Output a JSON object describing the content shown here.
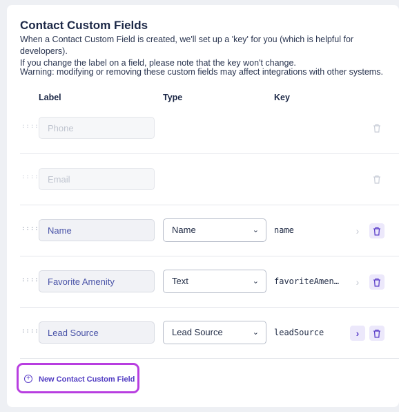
{
  "title": "Contact Custom Fields",
  "description_line1": "When a Contact Custom Field is created, we'll set up a 'key' for you (which is helpful for developers).",
  "description_line2": "If you change the label on a field, please note that the key won't change.",
  "warning": "Warning: modifying or removing these custom fields may affect integrations with other systems.",
  "columns": {
    "label": "Label",
    "type": "Type",
    "key": "Key"
  },
  "rows": [
    {
      "label": "Phone",
      "type": "",
      "key": "",
      "locked": true
    },
    {
      "label": "Email",
      "type": "",
      "key": "",
      "locked": true
    },
    {
      "label": "Name",
      "type": "Name",
      "key": "name",
      "locked": false
    },
    {
      "label": "Favorite Amenity",
      "type": "Text",
      "key": "favoriteAmen…",
      "locked": false
    },
    {
      "label": "Lead Source",
      "type": "Lead Source",
      "key": "leadSource",
      "locked": false,
      "arrow_active": true
    }
  ],
  "new_field_button": "New Contact Custom Field",
  "icons": {
    "drag": "drag-handle-icon",
    "chevron": "chevron-down-icon",
    "arrow": "chevron-right-icon",
    "trash": "trash-icon",
    "plus": "plus-circle-icon"
  },
  "colors": {
    "accent": "#5b3fc9",
    "highlight_border": "#b83ee0",
    "accent_bg": "#ece8fb"
  }
}
